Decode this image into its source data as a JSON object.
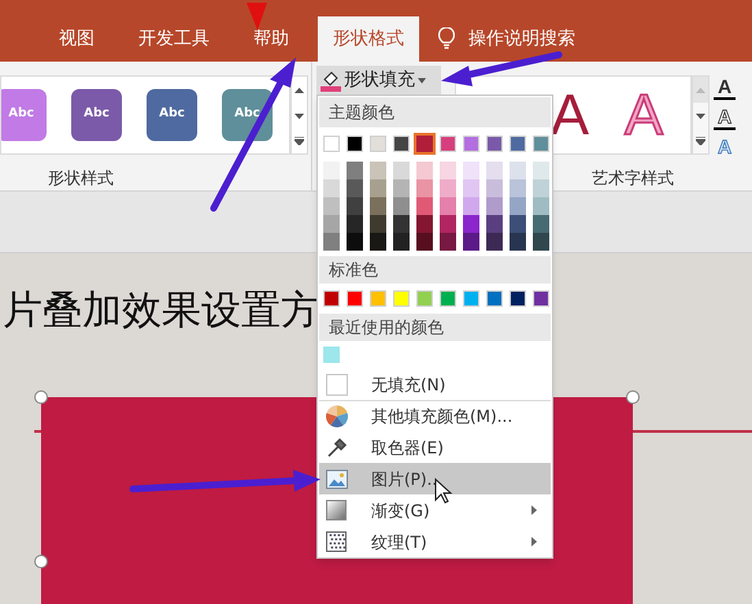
{
  "tabs": [
    {
      "label": "视图",
      "selected": false
    },
    {
      "label": "开发工具",
      "selected": false
    },
    {
      "label": "帮助",
      "selected": false
    },
    {
      "label": "形状格式",
      "selected": true
    }
  ],
  "tell_me": {
    "label": "操作说明搜索"
  },
  "shape_styles": {
    "group_label": "形状样式",
    "items": [
      {
        "label": "Abc",
        "color": "#c17ae6"
      },
      {
        "label": "Abc",
        "color": "#7b5aa9"
      },
      {
        "label": "Abc",
        "color": "#4f6aa0"
      },
      {
        "label": "Abc",
        "color": "#5f8f9a"
      }
    ]
  },
  "shape_fill_button": {
    "label": "形状填充"
  },
  "wordart_styles": {
    "group_label": "艺术字样式",
    "items": [
      {
        "label": "A",
        "kind": "fill"
      },
      {
        "label": "A",
        "kind": "outline"
      }
    ]
  },
  "text_options": [
    {
      "label": "A",
      "kind": "fill"
    },
    {
      "label": "A",
      "kind": "outline"
    },
    {
      "label": "A",
      "kind": "effects"
    }
  ],
  "fill_menu": {
    "theme_header": "主题颜色",
    "theme_colors": [
      {
        "color": "#ffffff",
        "selected": false,
        "shades": [
          {
            "color": "#f2f2f2"
          },
          {
            "color": "#d9d9d9"
          },
          {
            "color": "#bfbfbf"
          },
          {
            "color": "#a6a6a6"
          },
          {
            "color": "#808080"
          }
        ]
      },
      {
        "color": "#000000",
        "selected": false,
        "shades": [
          {
            "color": "#7f7f7f"
          },
          {
            "color": "#595959"
          },
          {
            "color": "#404040"
          },
          {
            "color": "#262626"
          },
          {
            "color": "#0d0d0d"
          }
        ]
      },
      {
        "color": "#e2dfda",
        "selected": false,
        "shades": [
          {
            "color": "#c9c3b8"
          },
          {
            "color": "#a8a08f"
          },
          {
            "color": "#7a705b"
          },
          {
            "color": "#3f3a2e"
          },
          {
            "color": "#1a1815"
          }
        ]
      },
      {
        "color": "#454545",
        "selected": false,
        "shades": [
          {
            "color": "#d9d9d9"
          },
          {
            "color": "#b4b4b4"
          },
          {
            "color": "#8f8f8f"
          },
          {
            "color": "#333333"
          },
          {
            "color": "#222222"
          }
        ]
      },
      {
        "color": "#b01e3a",
        "selected": true,
        "shades": [
          {
            "color": "#f4c9d1"
          },
          {
            "color": "#e994a4"
          },
          {
            "color": "#e05a76"
          },
          {
            "color": "#841630"
          },
          {
            "color": "#570f20"
          }
        ]
      },
      {
        "color": "#d63f7d",
        "selected": false,
        "shades": [
          {
            "color": "#f7d5e3"
          },
          {
            "color": "#efacc8"
          },
          {
            "color": "#e57fab"
          },
          {
            "color": "#b12562"
          },
          {
            "color": "#771942"
          }
        ]
      },
      {
        "color": "#b36ee0",
        "selected": false,
        "shades": [
          {
            "color": "#f0e2f9"
          },
          {
            "color": "#e1c5f3"
          },
          {
            "color": "#d1a8ed"
          },
          {
            "color": "#8a26cc"
          },
          {
            "color": "#5c1988"
          }
        ]
      },
      {
        "color": "#7a5aa8",
        "selected": false,
        "shades": [
          {
            "color": "#e4deee"
          },
          {
            "color": "#c9bddc"
          },
          {
            "color": "#af9ccb"
          },
          {
            "color": "#5a3f80"
          },
          {
            "color": "#3c2a55"
          }
        ]
      },
      {
        "color": "#4f6aa0",
        "selected": false,
        "shades": [
          {
            "color": "#dce1ec"
          },
          {
            "color": "#b9c3d9"
          },
          {
            "color": "#95a5c6"
          },
          {
            "color": "#3b4f78"
          },
          {
            "color": "#283550"
          }
        ]
      },
      {
        "color": "#5f8f9a",
        "selected": false,
        "shades": [
          {
            "color": "#dfe9eb"
          },
          {
            "color": "#bfd2d7"
          },
          {
            "color": "#9fbcc3"
          },
          {
            "color": "#476b73"
          },
          {
            "color": "#2f474d"
          }
        ]
      }
    ],
    "standard_header": "标准色",
    "standard_colors": [
      {
        "color": "#c00000"
      },
      {
        "color": "#ff0000"
      },
      {
        "color": "#ffc000"
      },
      {
        "color": "#ffff00"
      },
      {
        "color": "#92d050"
      },
      {
        "color": "#00b050"
      },
      {
        "color": "#00b0f0"
      },
      {
        "color": "#0070c0"
      },
      {
        "color": "#002060"
      },
      {
        "color": "#7030a0"
      }
    ],
    "recent_header": "最近使用的颜色",
    "recent_colors": [
      {
        "color": "#9ce6ec"
      }
    ],
    "items": [
      {
        "kind": "no_fill",
        "label": "无填充(N)",
        "selected": false,
        "submenu": false
      },
      {
        "kind": "more_colors",
        "label": "其他填充颜色(M)...",
        "selected": false,
        "submenu": false
      },
      {
        "kind": "eyedropper",
        "label": "取色器(E)",
        "selected": false,
        "submenu": false
      },
      {
        "kind": "picture",
        "label": "图片(P)...",
        "selected": true,
        "submenu": false
      },
      {
        "kind": "gradient",
        "label": "渐变(G)",
        "selected": false,
        "submenu": true
      },
      {
        "kind": "texture",
        "label": "纹理(T)",
        "selected": false,
        "submenu": true
      }
    ]
  },
  "slide": {
    "title": "片叠加效果设置方"
  }
}
